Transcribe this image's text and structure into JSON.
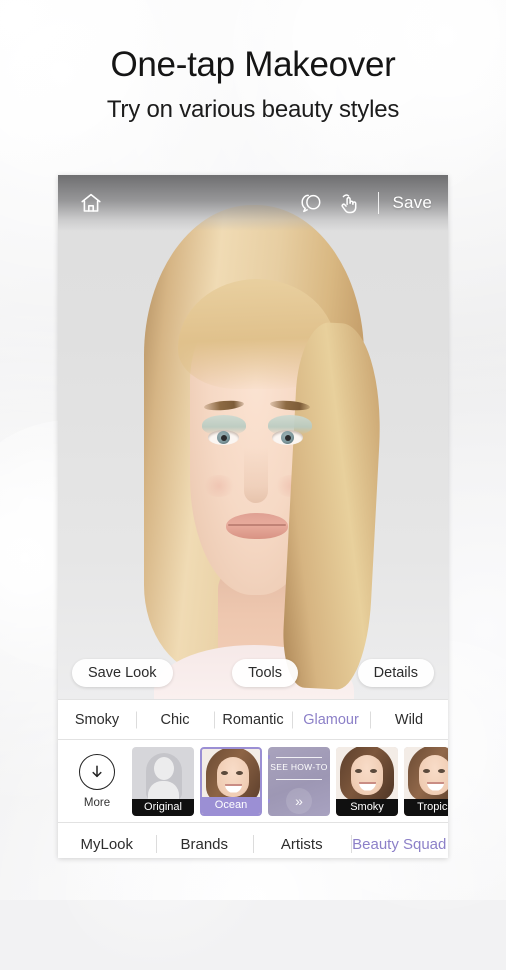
{
  "promo": {
    "headline": "One-tap Makeover",
    "subhead": "Try on various beauty styles"
  },
  "colors": {
    "accent_purple": "#8c80c8",
    "selected_thumb_border": "#9b8fd4",
    "label_bar": "#101010"
  },
  "toolbar": {
    "home_icon": "home-icon",
    "compare_icon": "compare-icon",
    "touch_icon": "hand-tap-icon",
    "save_label": "Save"
  },
  "photo_actions": [
    {
      "label": "Save Look",
      "name": "save-look-button"
    },
    {
      "label": "Tools",
      "name": "tools-button"
    },
    {
      "label": "Details",
      "name": "details-button"
    }
  ],
  "style_tabs": [
    {
      "label": "Smoky",
      "active": false
    },
    {
      "label": "Chic",
      "active": false
    },
    {
      "label": "Romantic",
      "active": false
    },
    {
      "label": "Glamour",
      "active": true
    },
    {
      "label": "Wild",
      "active": false
    }
  ],
  "presets": {
    "more": {
      "label": "More",
      "icon": "download-circle-icon"
    },
    "items": [
      {
        "label": "Original",
        "type": "silhouette",
        "selected": false
      },
      {
        "label": "Ocean",
        "type": "photo",
        "selected": true
      },
      {
        "label": "SEE HOW-TO",
        "type": "howto",
        "selected": false,
        "chevron": "»"
      },
      {
        "label": "Smoky",
        "type": "photo",
        "selected": false
      },
      {
        "label": "Tropics",
        "type": "photo",
        "selected": false
      }
    ]
  },
  "bottom_nav": [
    {
      "label": "MyLook",
      "active": false
    },
    {
      "label": "Brands",
      "active": false
    },
    {
      "label": "Artists",
      "active": false
    },
    {
      "label": "Beauty Squad",
      "active": true
    }
  ]
}
